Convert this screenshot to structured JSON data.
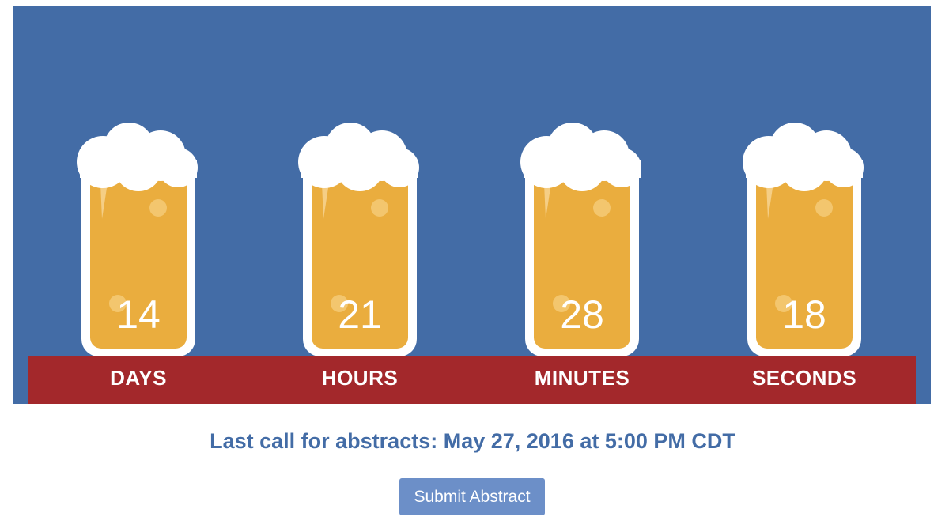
{
  "countdown": {
    "units": [
      {
        "value": "14",
        "label": "DAYS"
      },
      {
        "value": "21",
        "label": "HOURS"
      },
      {
        "value": "28",
        "label": "MINUTES"
      },
      {
        "value": "18",
        "label": "SECONDS"
      }
    ]
  },
  "deadline": {
    "text": "Last call for abstracts: May 27, 2016 at 5:00 PM CDT"
  },
  "submit": {
    "label": "Submit Abstract"
  },
  "colors": {
    "background_blue": "#436ca6",
    "label_bar_red": "#a3282b",
    "beer_amber": "#eaad3e",
    "foam_white": "#ffffff",
    "deadline_text": "#436ca6",
    "button_bg": "#6c8fc8"
  },
  "icons": {
    "glass": "beer-glass-icon",
    "foam": "beer-foam-icon"
  }
}
